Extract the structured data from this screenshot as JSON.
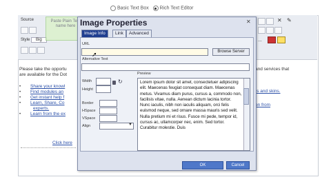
{
  "editor_mode": {
    "option_basic": "Basic Text Box",
    "option_rich": "Rich Text Editor",
    "selected": "rich"
  },
  "toolbar": {
    "source_label": "Source",
    "style_label": "Style",
    "style_value": "Big",
    "dots": "..."
  },
  "tooltip": {
    "text": "Paste Plain Text name here"
  },
  "background_content": {
    "intro": "Please take the opportu",
    "intro_line2": "are available for the Dot",
    "right_line1": "and services that",
    "right_line3": "rs and skins.",
    "right_line5": "on from",
    "bullets": [
      "Share your knowl",
      "Find modules an",
      "Get instant help f",
      "Learn, Share, Co",
      "experts.",
      "Learn from the ex"
    ],
    "click_here": "Click here"
  },
  "dialog": {
    "title": "Image Properties",
    "tabs": [
      "Image Info",
      "Link",
      "Advanced"
    ],
    "active_tab": "Image Info",
    "url_label": "URL",
    "url_value": "",
    "browse_button": "Browse Server",
    "alt_label": "Alternative Text",
    "alt_value": "",
    "width_label": "Width",
    "height_label": "Height",
    "border_label": "Border",
    "hspace_label": "HSpace",
    "vspace_label": "VSpace",
    "align_label": "Align",
    "preview_label": "Preview",
    "preview_text": "Lorem ipsum dolor sit amet, consectetuer adipiscing elit. Maecenas feugiat consequat diam. Maecenas metus. Vivamus diam purus, cursus a, commodo non, facilisis vitae, nulla. Aenean dictum lacinia tortor. Nunc iaculis, nibh non iaculis aliquam, orci felis euismod neque, sed ornare massa mauris sed velit. Nulla pretium mi et risus. Fusce mi pede, tempor id, cursus ac, ullamcorper nec, enim. Sed tortor. Curabitur molestie. Duis",
    "ok_button": "OK",
    "cancel_button": "Cancel"
  },
  "colors": {
    "dialog_bg": "#dde2ee",
    "tab_active": "#203f90",
    "ok_blue": "#4f78c9"
  }
}
